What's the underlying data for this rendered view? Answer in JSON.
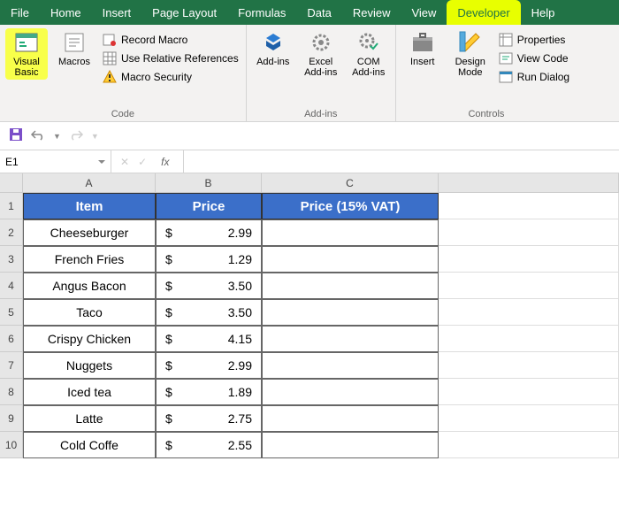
{
  "tabs": {
    "file": "File",
    "home": "Home",
    "insert": "Insert",
    "page_layout": "Page Layout",
    "formulas": "Formulas",
    "data": "Data",
    "review": "Review",
    "view": "View",
    "developer": "Developer",
    "help": "Help"
  },
  "ribbon": {
    "code": {
      "visual_basic": "Visual Basic",
      "macros": "Macros",
      "record_macro": "Record Macro",
      "use_rel": "Use Relative References",
      "macro_sec": "Macro Security",
      "label": "Code"
    },
    "addins": {
      "addins": "Add-ins",
      "excel": "Excel Add-ins",
      "com": "COM Add-ins",
      "label": "Add-ins"
    },
    "controls": {
      "insert": "Insert",
      "design": "Design Mode",
      "properties": "Properties",
      "view_code": "View Code",
      "run_dialog": "Run Dialog",
      "label": "Controls"
    }
  },
  "namebox": "E1",
  "fx": "fx",
  "headers": {
    "A": "A",
    "B": "B",
    "C": "C"
  },
  "table": {
    "h_item": "Item",
    "h_price": "Price",
    "h_vat": "Price (15% VAT)",
    "rows": [
      {
        "n": "1"
      },
      {
        "n": "2",
        "item": "Cheeseburger",
        "cur": "$",
        "price": "2.99"
      },
      {
        "n": "3",
        "item": "French Fries",
        "cur": "$",
        "price": "1.29"
      },
      {
        "n": "4",
        "item": "Angus Bacon",
        "cur": "$",
        "price": "3.50"
      },
      {
        "n": "5",
        "item": "Taco",
        "cur": "$",
        "price": "3.50"
      },
      {
        "n": "6",
        "item": "Crispy Chicken",
        "cur": "$",
        "price": "4.15"
      },
      {
        "n": "7",
        "item": "Nuggets",
        "cur": "$",
        "price": "2.99"
      },
      {
        "n": "8",
        "item": "Iced tea",
        "cur": "$",
        "price": "1.89"
      },
      {
        "n": "9",
        "item": "Latte",
        "cur": "$",
        "price": "2.75"
      },
      {
        "n": "10",
        "item": "Cold Coffe",
        "cur": "$",
        "price": "2.55"
      }
    ]
  }
}
